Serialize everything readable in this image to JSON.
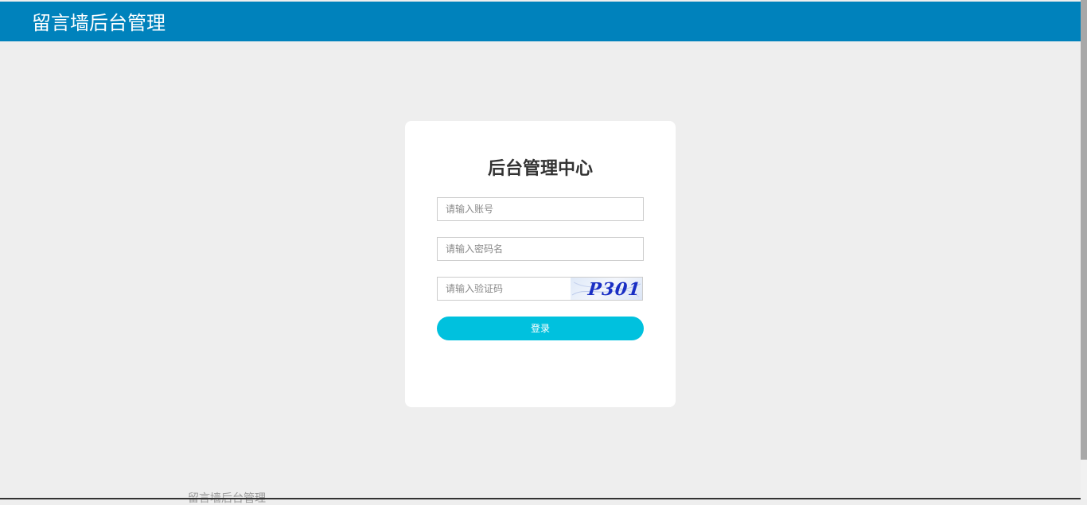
{
  "header": {
    "app_title": "留言墙后台管理"
  },
  "login": {
    "title": "后台管理中心",
    "account_placeholder": "请输入账号",
    "password_placeholder": "请输入密码名",
    "captcha_placeholder": "请输入验证码",
    "captcha_text": "P301",
    "submit_label": "登录"
  },
  "footer": {
    "text": "留言墙后台管理"
  },
  "colors": {
    "header_bg": "#0082bc",
    "page_bg": "#eeeeee",
    "button_bg": "#00c1de"
  }
}
